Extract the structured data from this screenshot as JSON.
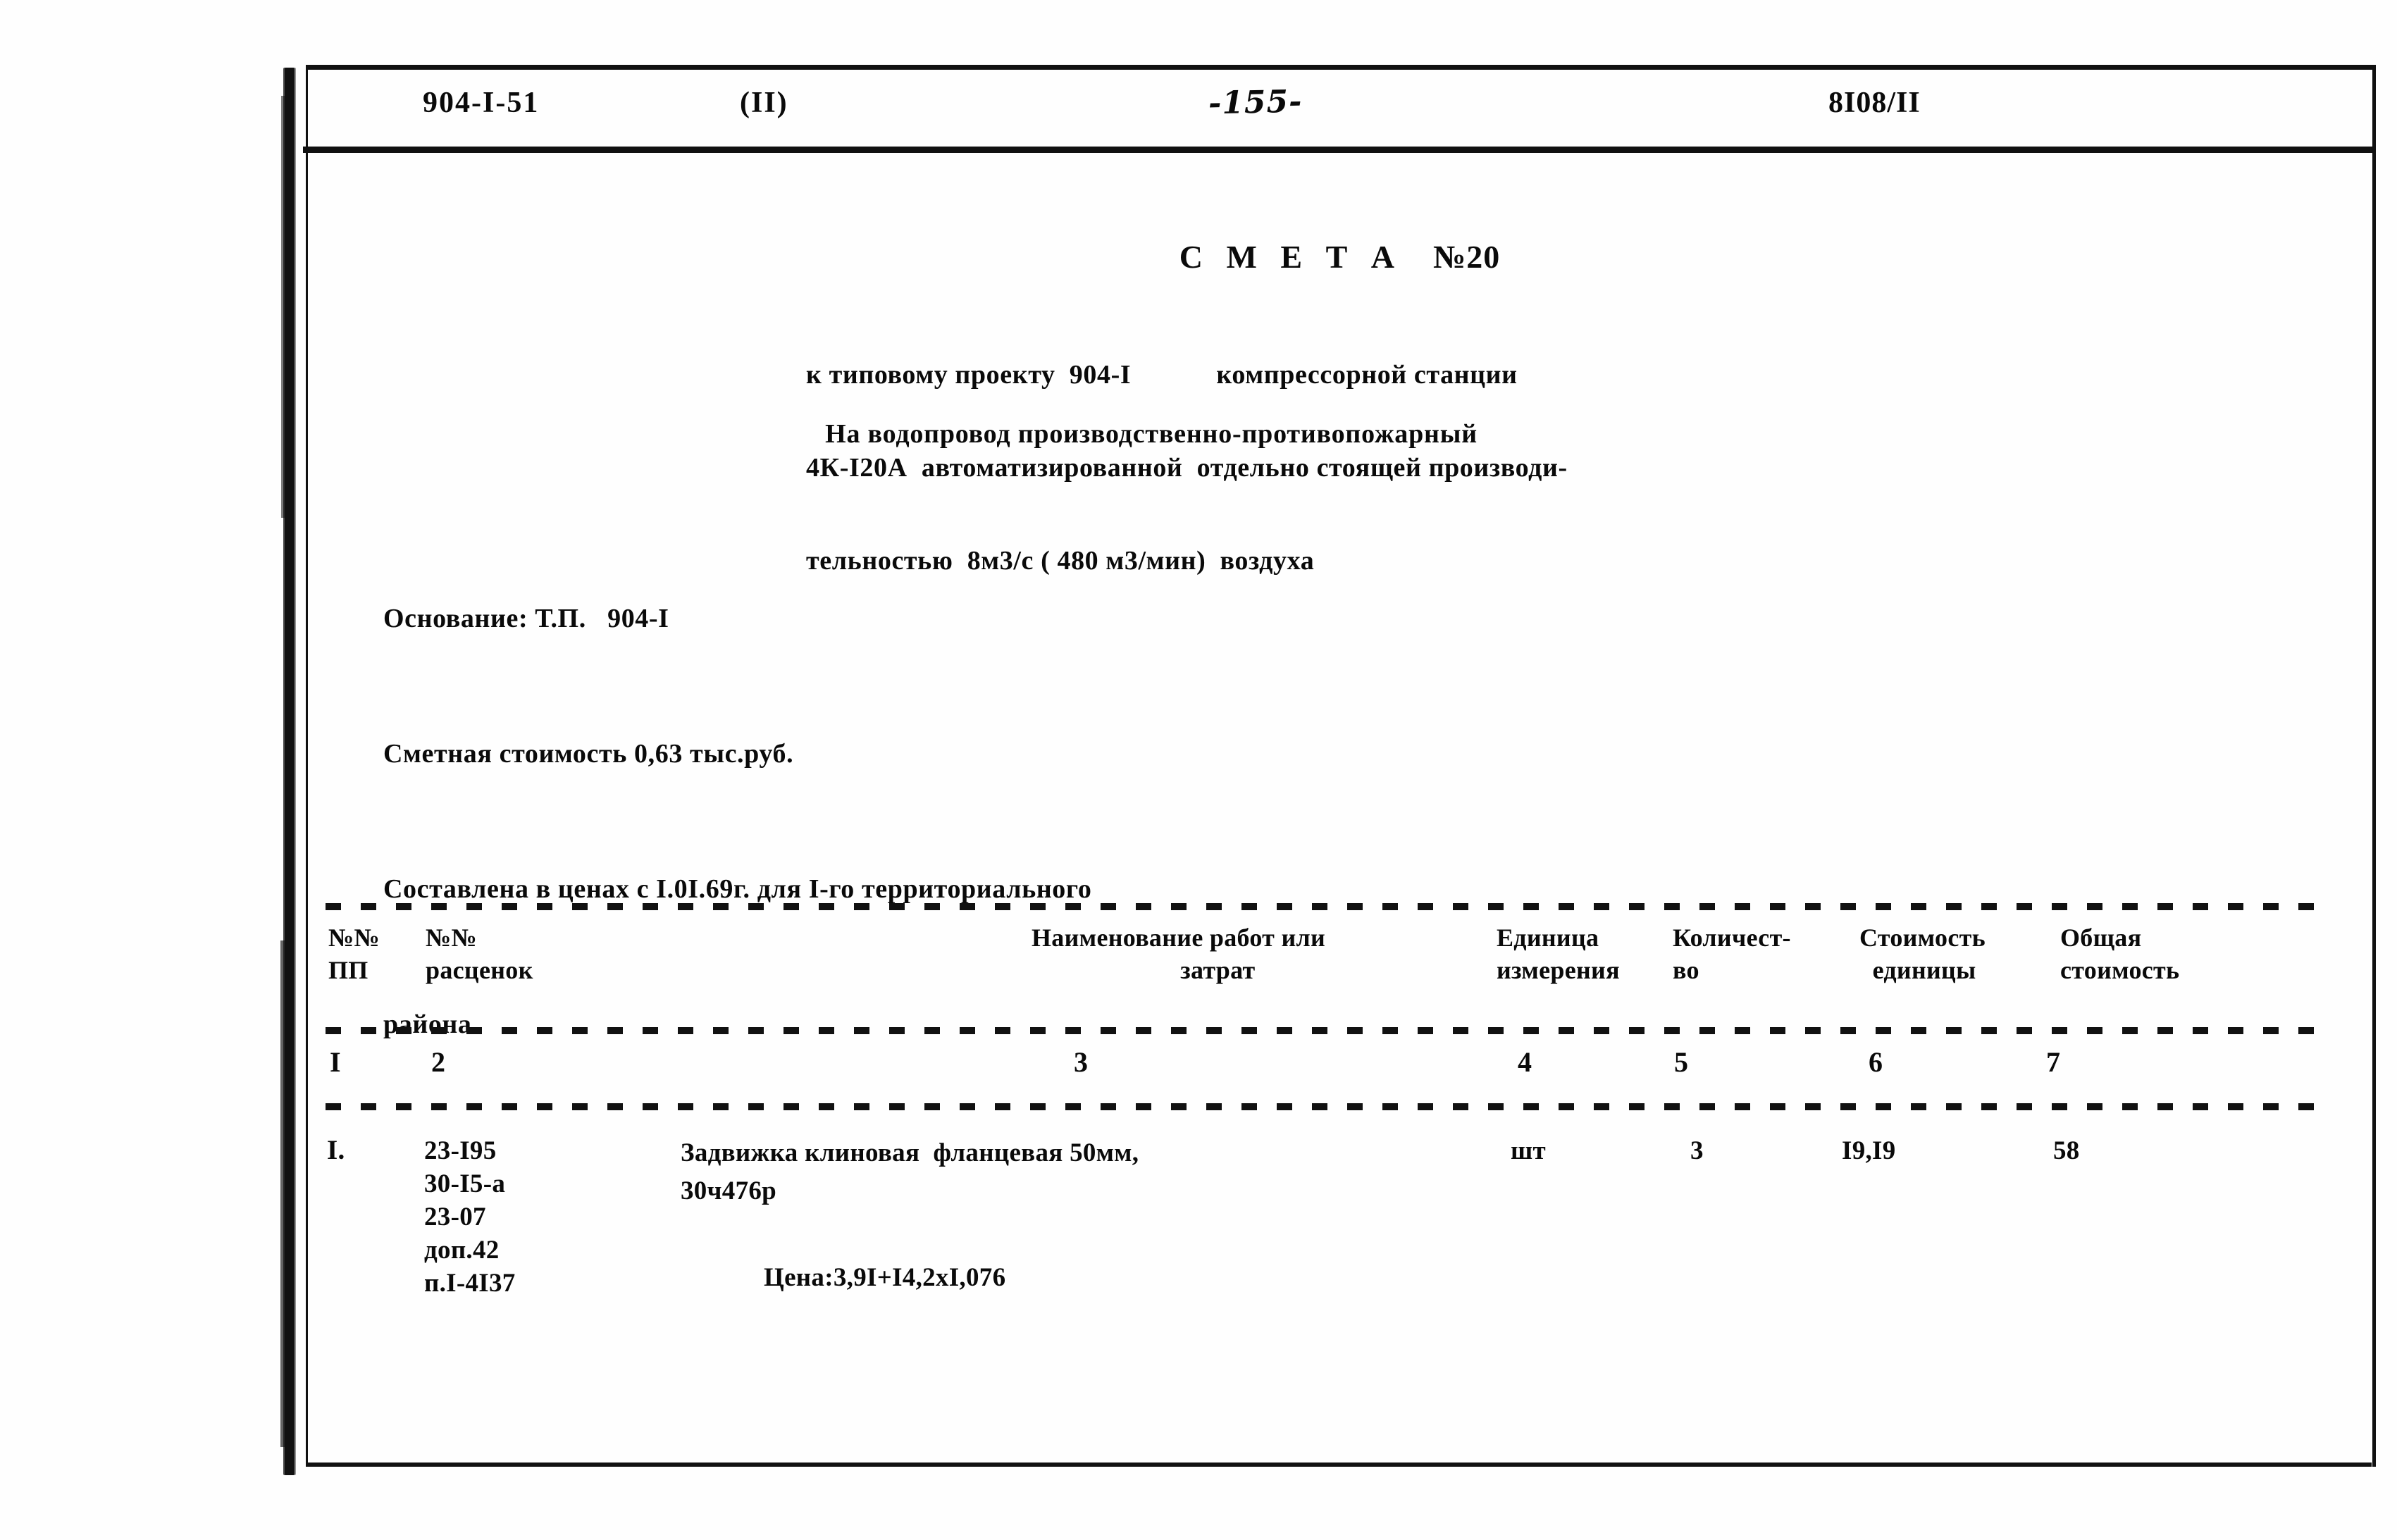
{
  "page_header": {
    "project_code": "904-I-51",
    "part": "(II)",
    "page_number": "-155-",
    "document_number": "8I08/II"
  },
  "document": {
    "title": "С М Е Т А",
    "title_number": "№20",
    "intro_lines": [
      "к типовому проекту  904-I            компрессорной станции",
      "4К-I20А  автоматизированной  отдельно стоящей производи-",
      "тельностью  8м3/с ( 480 м3/мин)  воздуха"
    ],
    "subtitle": "На водопровод производственно-противопожарный",
    "basis_lines": [
      "Основание: Т.П.   904-I",
      "Сметная стоимость 0,63 тыс.руб.",
      "Составлена в ценах с I.0I.69г. для I-го территориального",
      "района."
    ]
  },
  "table": {
    "headers": {
      "pp": "№№\nПП",
      "rascenok": "№№\nрасценок",
      "naimenovanie": "Наименование работ или\n            затрат",
      "edinica": "Единица\nизмерения",
      "kolichestvo": "Количест-\nво",
      "stoimost_edinicy": "Стоимость\n  единицы",
      "obshaya_stoimost": "Общая\nстоимость"
    },
    "column_numbers": [
      "I",
      "2",
      "3",
      "4",
      "5",
      "6",
      "7"
    ],
    "rows": [
      {
        "index": "I.",
        "codes": "23-I95\n30-I5-а\n23-07\nдоп.42\nп.I-4I37",
        "description": "Задвижка клиновая  фланцевая 50мм,\n30ч476р",
        "price_note": "Цена:3,9I+I4,2xI,076",
        "unit": "шт",
        "quantity": "3",
        "unit_cost": "I9,I9",
        "total_cost": "58"
      }
    ]
  }
}
